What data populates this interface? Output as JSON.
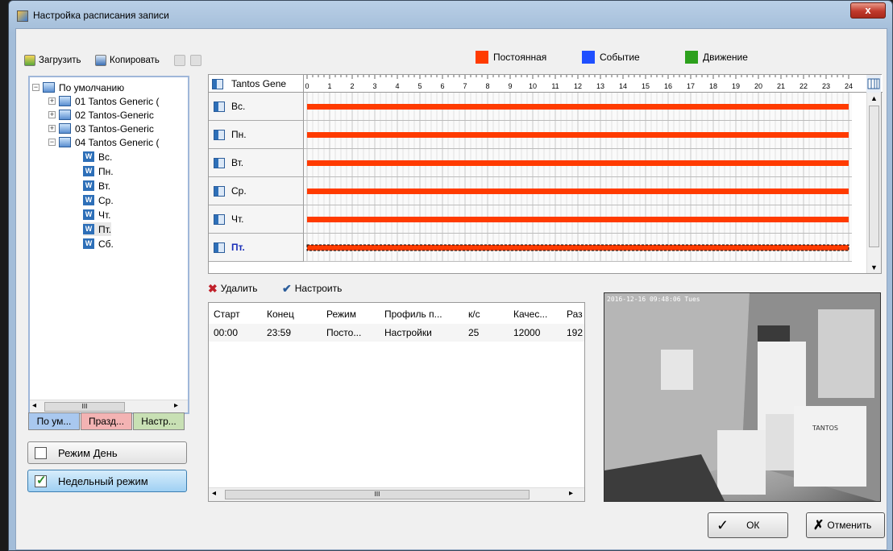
{
  "window": {
    "title": "Настройка расписания записи",
    "close_label": "x"
  },
  "toolbar": {
    "load_label": "Загрузить",
    "copy_label": "Копировать"
  },
  "legend": [
    {
      "label": "Постоянная",
      "color": "#ff3b00"
    },
    {
      "label": "Событие",
      "color": "#1f4fff"
    },
    {
      "label": "Движение",
      "color": "#2ca01c"
    }
  ],
  "tree": {
    "root": "По умолчанию",
    "cameras": [
      "01 Tantos Generic (",
      "02 Tantos-Generic",
      "03 Tantos-Generic",
      "04 Tantos Generic ("
    ],
    "days": [
      "Вс.",
      "Пн.",
      "Вт.",
      "Ср.",
      "Чт.",
      "Пт.",
      "Сб."
    ],
    "selected_day": "Пт.",
    "scroll_mark": "III"
  },
  "bottom_tabs": [
    "По ум...",
    "Празд...",
    "Настр..."
  ],
  "modes": {
    "day_label": "Режим День",
    "week_label": "Недельный режим"
  },
  "schedule": {
    "header_label": "Tantos Gene",
    "hours": [
      "0",
      "1",
      "2",
      "3",
      "4",
      "5",
      "6",
      "7",
      "8",
      "9",
      "10",
      "11",
      "12",
      "13",
      "14",
      "15",
      "16",
      "17",
      "18",
      "19",
      "20",
      "21",
      "22",
      "23",
      "24"
    ],
    "days": [
      {
        "label": "Вс.",
        "start": 0,
        "end": 24
      },
      {
        "label": "Пн.",
        "start": 0,
        "end": 24
      },
      {
        "label": "Вт.",
        "start": 0,
        "end": 24
      },
      {
        "label": "Ср.",
        "start": 0,
        "end": 24
      },
      {
        "label": "Чт.",
        "start": 0,
        "end": 24
      },
      {
        "label": "Пт.",
        "start": 0,
        "end": 24,
        "selected": true
      }
    ],
    "bar_color": "#ff3b00"
  },
  "actions": {
    "delete_label": "Удалить",
    "configure_label": "Настроить"
  },
  "table": {
    "columns": [
      "Старт",
      "Конец",
      "Режим",
      "Профиль п...",
      "к/с",
      "Качес...",
      "Раз"
    ],
    "rows": [
      [
        "00:00",
        "23:59",
        "Посто...",
        "Настройки",
        "25",
        "12000",
        "192"
      ]
    ],
    "scroll_mark": "III"
  },
  "preview": {
    "timestamp": "2016-12-16 09:48:06 Tues",
    "sign_text": "TANTOS"
  },
  "dialog": {
    "ok_label": "ОК",
    "cancel_label": "Отменить"
  }
}
